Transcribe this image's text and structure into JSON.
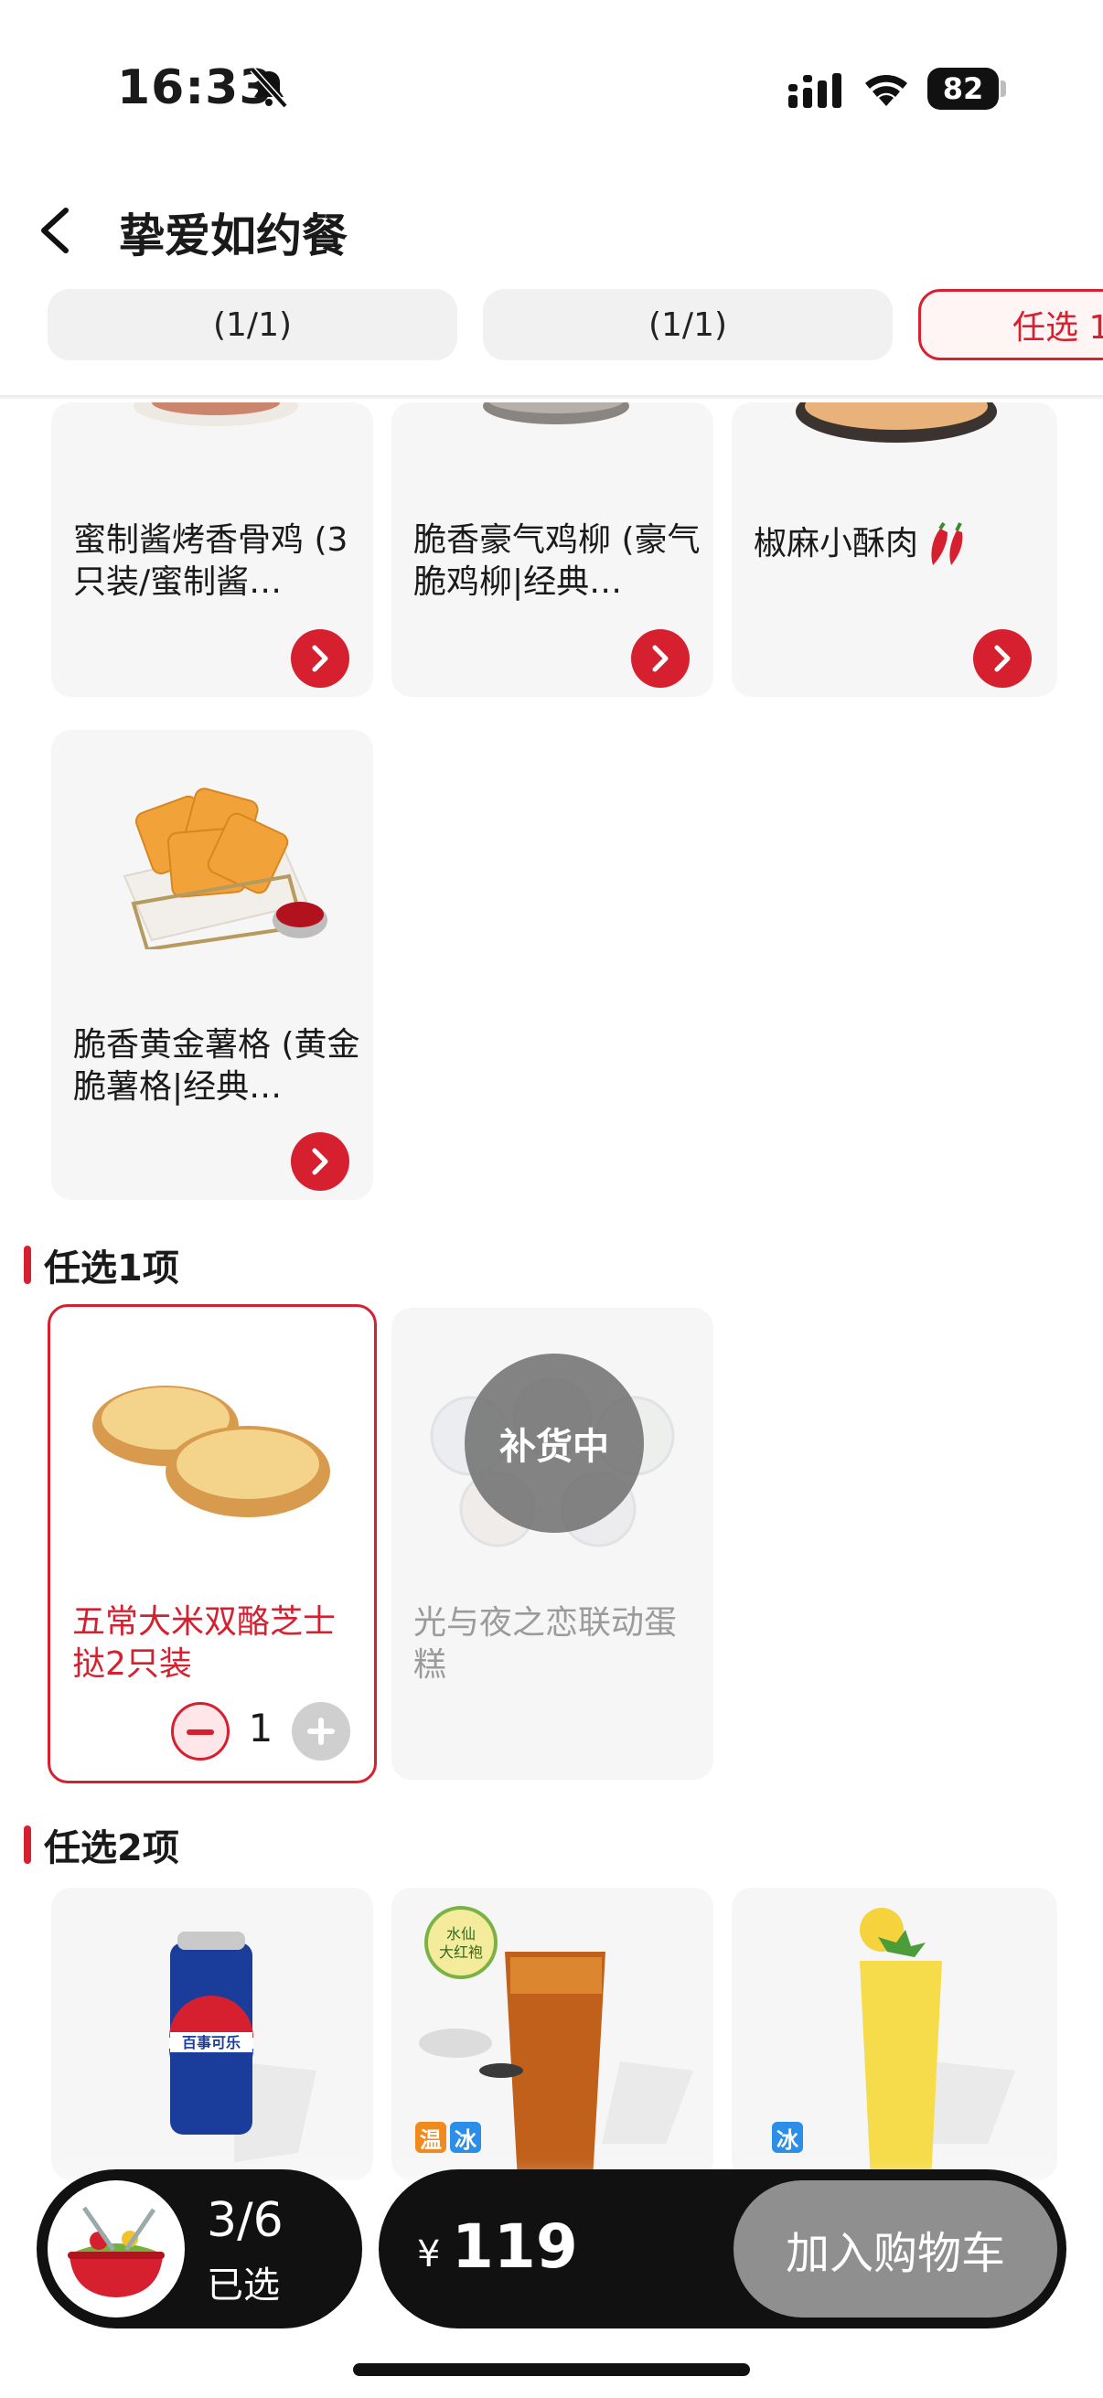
{
  "status_bar": {
    "time": "16:33",
    "battery": "82"
  },
  "header": {
    "title": "挚爱如约餐"
  },
  "tabs": [
    {
      "label": "(1/1)"
    },
    {
      "label": "(1/1)"
    },
    {
      "label": "任选 1"
    }
  ],
  "group_a": {
    "items": [
      {
        "name": "蜜制酱烤香骨鸡 (3只装/蜜制酱…"
      },
      {
        "name": "脆香豪气鸡柳 (豪气脆鸡柳|经典…"
      },
      {
        "name": "椒麻小酥肉"
      },
      {
        "name": "脆香黄金薯格 (黄金脆薯格|经典…"
      }
    ]
  },
  "section_b": {
    "title": "任选1项",
    "items": [
      {
        "name": "五常大米双酪芝士挞2只装",
        "quantity": "1"
      },
      {
        "name": "光与夜之恋联动蛋糕",
        "badge": "补货中"
      }
    ]
  },
  "section_c": {
    "title": "任选2项",
    "items": [
      {
        "name": "百事可乐",
        "pic_text": "百事可乐"
      },
      {
        "pic_text_1": "水仙",
        "pic_text_2": "大红袍",
        "tags": [
          "温",
          "冰"
        ]
      },
      {
        "tags": [
          "冰"
        ]
      }
    ]
  },
  "bottom_bar": {
    "count": "3/6",
    "count_label": "已选",
    "currency": "¥",
    "price": "119",
    "cart_button": "加入购物车"
  },
  "colors": {
    "brand_red": "#d6202f",
    "tag_orange": "#f08a1c",
    "tag_blue": "#2b8ee8"
  }
}
